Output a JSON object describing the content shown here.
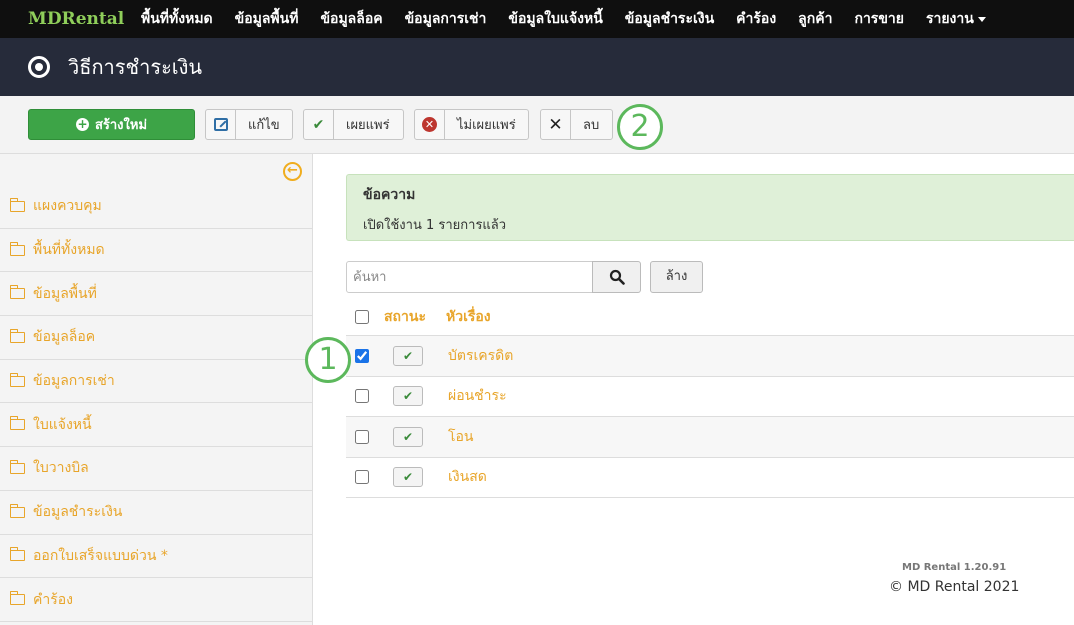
{
  "navbar": {
    "brand": "MDRental",
    "items": [
      {
        "label": "พื้นที่ทั้งหมด"
      },
      {
        "label": "ข้อมูลพื้นที่"
      },
      {
        "label": "ข้อมูลล็อค"
      },
      {
        "label": "ข้อมูลการเช่า"
      },
      {
        "label": "ข้อมูลใบแจ้งหนี้"
      },
      {
        "label": "ข้อมูลชำระเงิน"
      },
      {
        "label": "คำร้อง"
      },
      {
        "label": "ลูกค้า"
      },
      {
        "label": "การขาย"
      },
      {
        "label": "รายงาน"
      }
    ]
  },
  "header": {
    "title": "วิธีการชำระเงิน",
    "icon": "radio-dot-icon"
  },
  "toolbar": {
    "new_label": "สร้างใหม่",
    "edit_label": "แก้ไข",
    "publish_label": "เผยแพร่",
    "unpublish_label": "ไม่เผยแพร่",
    "delete_label": "ลบ"
  },
  "callouts": [
    "1",
    "2"
  ],
  "sidebar": {
    "items": [
      {
        "label": "แผงควบคุม"
      },
      {
        "label": "พื้นที่ทั้งหมด"
      },
      {
        "label": "ข้อมูลพื้นที่"
      },
      {
        "label": "ข้อมูลล็อค"
      },
      {
        "label": "ข้อมูลการเช่า"
      },
      {
        "label": "ใบแจ้งหนี้"
      },
      {
        "label": "ใบวางบิล"
      },
      {
        "label": "ข้อมูลชำระเงิน"
      },
      {
        "label": "ออกใบเสร็จแบบด่วน *"
      },
      {
        "label": "คำร้อง"
      }
    ]
  },
  "alert": {
    "title": "ข้อความ",
    "message": "เปิดใช้งาน 1 รายการแล้ว"
  },
  "search": {
    "placeholder": "ค้นหา",
    "value": "",
    "clear_label": "ล้าง"
  },
  "table": {
    "columns": [
      "สถานะ",
      "หัวเรื่อง"
    ],
    "rows": [
      {
        "title": "บัตรเครดิต",
        "checked": true,
        "published": true
      },
      {
        "title": "ผ่อนชำระ",
        "checked": false,
        "published": true
      },
      {
        "title": "โอน",
        "checked": false,
        "published": true
      },
      {
        "title": "เงินสด",
        "checked": false,
        "published": true
      }
    ]
  },
  "footer": {
    "version": "MD Rental 1.20.91",
    "copyright": "© MD Rental 2021"
  },
  "colors": {
    "accent": "#e8a52a",
    "primary_button": "#3da447",
    "callout": "#5cb85c"
  }
}
